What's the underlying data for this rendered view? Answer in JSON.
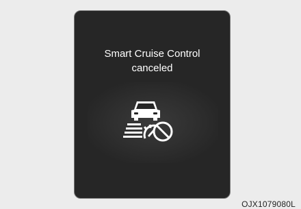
{
  "display": {
    "message_line1": "Smart Cruise Control",
    "message_line2": "canceled",
    "icon": "smart-cruise-control-canceled-icon"
  },
  "image_code": "OJX1079080L",
  "colors": {
    "panel_background": "#262626",
    "text": "#ffffff",
    "page_background": "#ececec"
  }
}
